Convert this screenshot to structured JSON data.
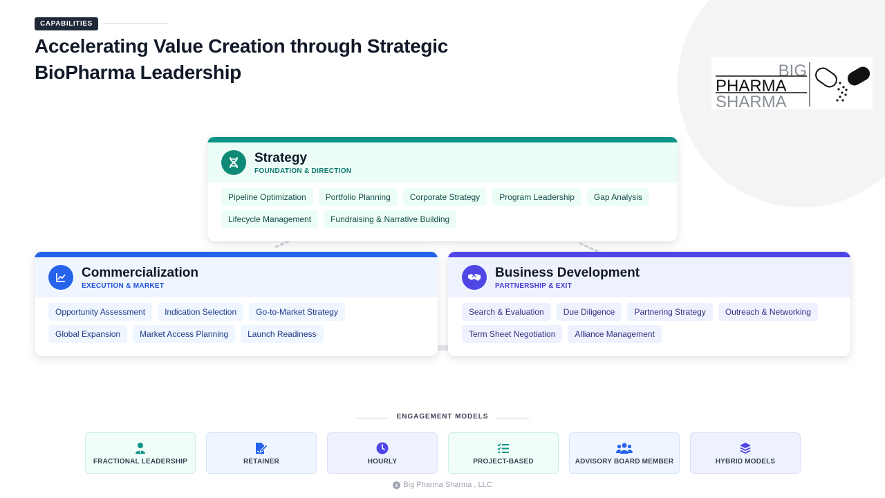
{
  "header": {
    "tag": "CAPABILITIES",
    "title": "Accelerating Value Creation through Strategic BioPharma Leadership"
  },
  "logo": {
    "line1": "BIG",
    "line2": "PHARMA",
    "line3": "SHARMA"
  },
  "cards": {
    "strategy": {
      "title": "Strategy",
      "subtitle": "FOUNDATION & DIRECTION",
      "icon": "dna-icon",
      "accent": "#0d9488",
      "chips": [
        "Pipeline Optimization",
        "Portfolio Planning",
        "Corporate Strategy",
        "Program Leadership",
        "Gap Analysis",
        "Lifecycle Management",
        "Fundraising & Narrative Building"
      ]
    },
    "commercialization": {
      "title": "Commercialization",
      "subtitle": "EXECUTION & MARKET",
      "icon": "line-chart-icon",
      "accent": "#2563eb",
      "chips": [
        "Opportunity Assessment",
        "Indication Selection",
        "Go-to-Market Strategy",
        "Global Expansion",
        "Market Access Planning",
        "Launch Readiness"
      ]
    },
    "business_development": {
      "title": "Business Development",
      "subtitle": "PARTNERSHIP & EXIT",
      "icon": "handshake-icon",
      "accent": "#4f46e5",
      "chips": [
        "Search & Evaluation",
        "Due Diligence",
        "Partnering Strategy",
        "Outreach & Networking",
        "Term Sheet Negotiation",
        "Alliance Management"
      ]
    }
  },
  "engagement": {
    "label": "ENGAGEMENT MODELS",
    "models": [
      {
        "label": "FRACTIONAL LEADERSHIP",
        "icon": "user-tie-icon",
        "color": "#0d9488"
      },
      {
        "label": "RETAINER",
        "icon": "file-signature-icon",
        "color": "#2563eb"
      },
      {
        "label": "HOURLY",
        "icon": "clock-icon",
        "color": "#4f46e5"
      },
      {
        "label": "PROJECT-BASED",
        "icon": "task-list-icon",
        "color": "#0d9488"
      },
      {
        "label": "ADVISORY BOARD MEMBER",
        "icon": "users-icon",
        "color": "#2563eb"
      },
      {
        "label": "HYBRID MODELS",
        "icon": "layers-icon",
        "color": "#4f46e5"
      }
    ]
  },
  "footer": {
    "text": "Big Pharma Sharma , LLC"
  }
}
